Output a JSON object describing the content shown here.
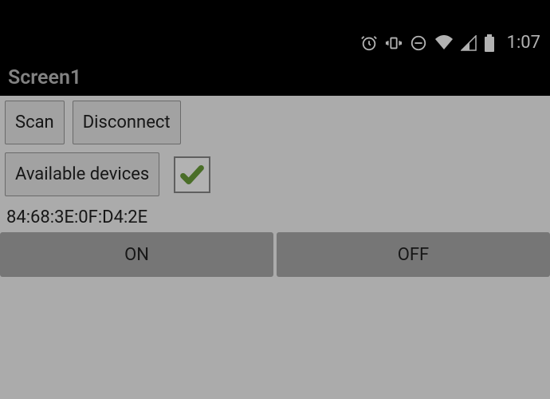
{
  "status": {
    "time": "1:07"
  },
  "title": "Screen1",
  "buttons": {
    "scan": "Scan",
    "disconnect": "Disconnect",
    "available_devices": "Available devices",
    "on": "ON",
    "off": "OFF"
  },
  "device": {
    "mac_address": "84:68:3E:0F:D4:2E"
  },
  "checkbox": {
    "checked": true
  }
}
